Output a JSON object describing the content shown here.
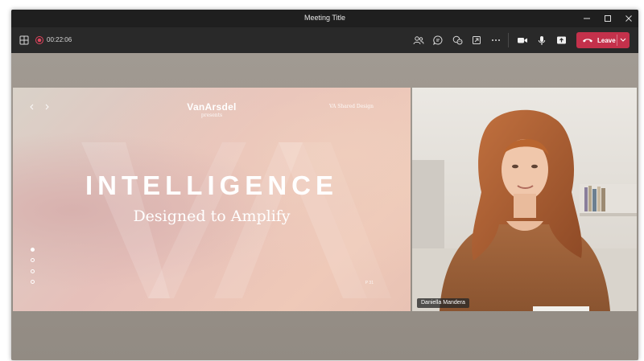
{
  "window": {
    "title": "Meeting Title"
  },
  "toolbar": {
    "timer": "00:22:06",
    "leave_label": "Leave",
    "icons": [
      "layout-icon",
      "recording-icon",
      "people-icon",
      "chat-icon",
      "reactions-icon",
      "share-tray-icon",
      "more-icon",
      "camera-icon",
      "mic-icon",
      "share-icon",
      "phone-hangup-icon",
      "chevron-down-icon"
    ]
  },
  "slide": {
    "brand": "VanArsdel",
    "brand_sub": "presents",
    "tag": "VA Shared Design",
    "headline": "INTELLIGENCE",
    "subline": "Designed to Amplify",
    "page": "P 31",
    "dots_count": 4,
    "active_dot": 1
  },
  "video": {
    "participant_name": "Daniella Mandera"
  },
  "colors": {
    "titlebar": "#1f1f1f",
    "toolbar": "#292929",
    "leave": "#c4314b",
    "stage": "#9a948c"
  }
}
